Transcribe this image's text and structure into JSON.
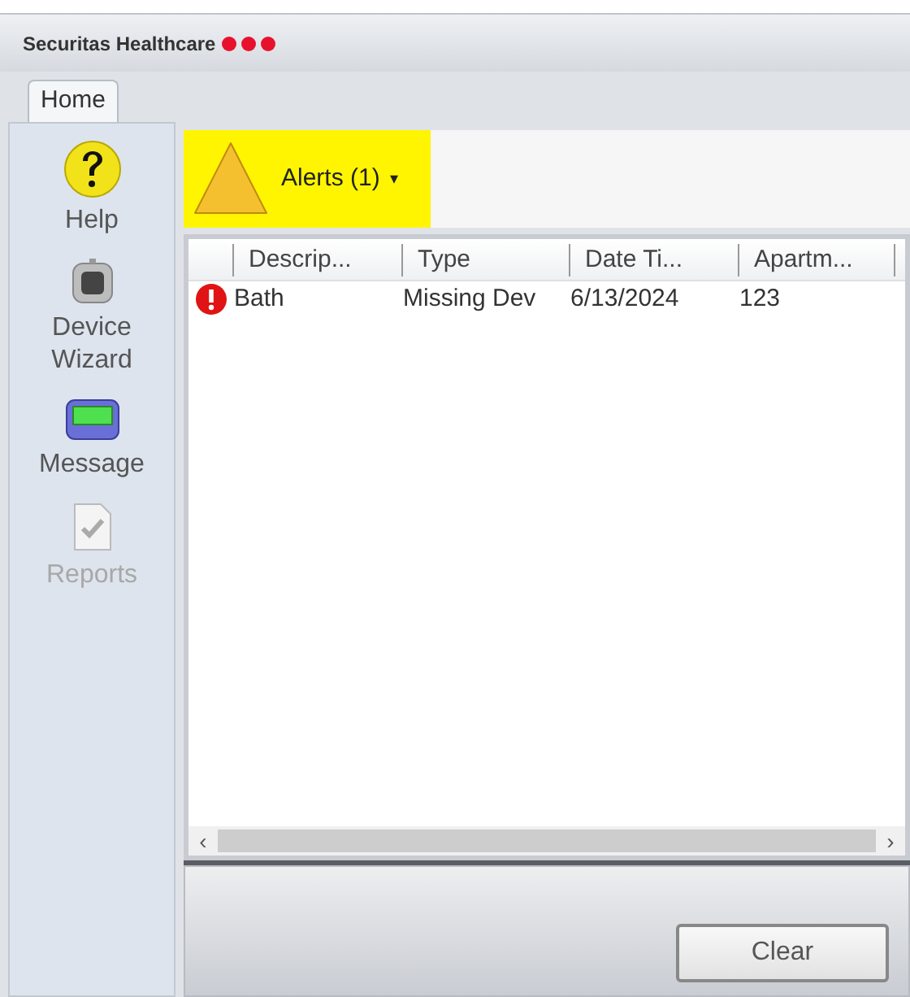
{
  "window": {
    "title": "Securitas Healthcare"
  },
  "tabs": [
    {
      "label": "Home",
      "selected": true
    }
  ],
  "sidebar": {
    "items": [
      {
        "kind": "help",
        "label": "Help",
        "disabled": false
      },
      {
        "kind": "device",
        "label": "Device Wizard",
        "disabled": false
      },
      {
        "kind": "pager",
        "label": "Message",
        "disabled": false
      },
      {
        "kind": "report",
        "label": "Reports",
        "disabled": true
      }
    ]
  },
  "alerts_button": {
    "label": "Alerts (1)",
    "caret": "▾"
  },
  "table": {
    "columns": [
      "Descrip...",
      "Type",
      "Date Ti...",
      "Apartm..."
    ],
    "rows": [
      {
        "kind": "error",
        "cells": [
          "Bath",
          "Missing Dev",
          "6/13/2024",
          "123"
        ]
      }
    ]
  },
  "scrollbar": {
    "left": "‹",
    "right": "›"
  },
  "buttons": [
    "Clear"
  ]
}
